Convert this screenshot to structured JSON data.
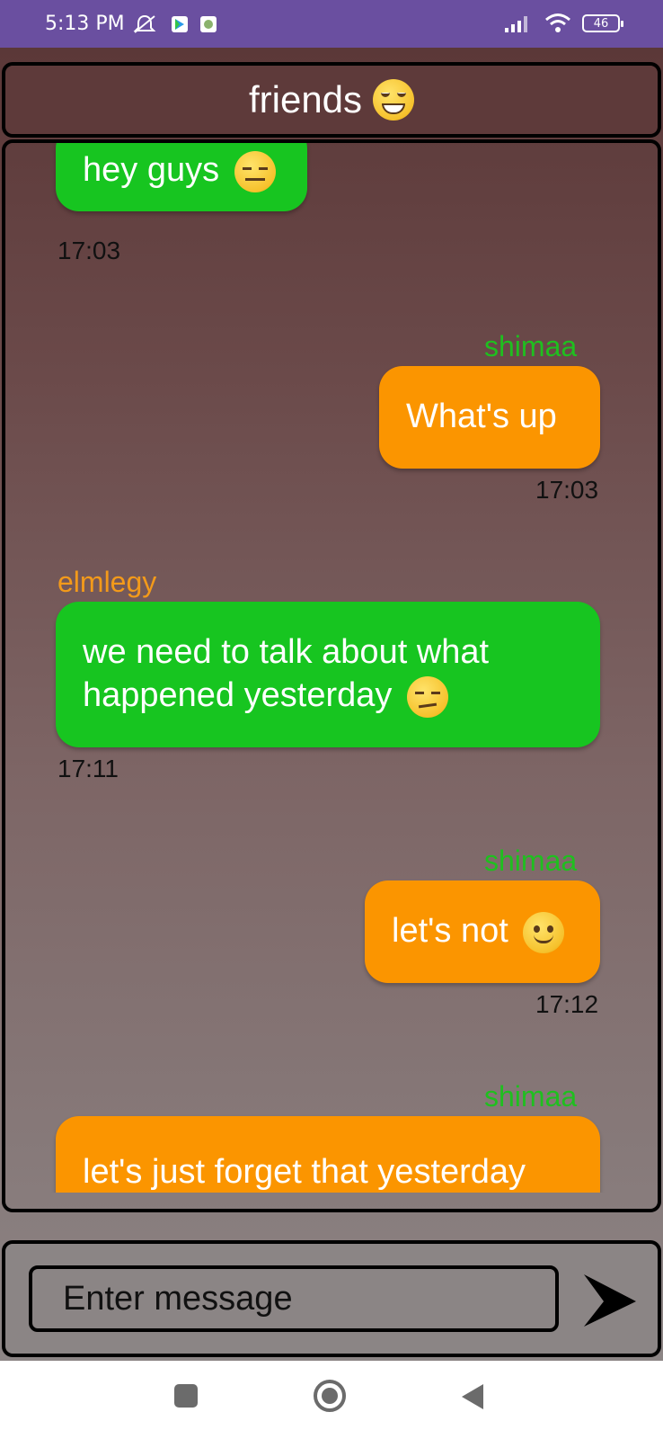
{
  "status_bar": {
    "time": "5:13 PM",
    "battery": "46",
    "icons": [
      "mute-icon",
      "app-icon-1",
      "app-icon-2",
      "signal-icon",
      "wifi-icon",
      "battery-icon"
    ]
  },
  "header": {
    "title": "friends",
    "emoji": "grinning-emoji-icon"
  },
  "messages": [
    {
      "sender": "",
      "text": "hey guys",
      "emoji": "expressionless-emoji-icon",
      "time": "17:03",
      "side": "left",
      "color": "#17c520"
    },
    {
      "sender": "shimaa",
      "text": "What's up",
      "time": "17:03",
      "side": "right",
      "color": "#fb9500"
    },
    {
      "sender": "elmlegy",
      "text_line1": "we need to talk about what",
      "text_line2": "happened yesterday",
      "emoji": "unamused-emoji-icon",
      "time": "17:11",
      "side": "left",
      "color": "#17c520"
    },
    {
      "sender": "shimaa",
      "text": "let's not",
      "emoji": "slight-smile-emoji-icon",
      "time": "17:12",
      "side": "right",
      "color": "#fb9500"
    },
    {
      "sender": "shimaa",
      "text": "let's just forget that yesterday",
      "side": "left",
      "color": "#fb9500"
    }
  ],
  "composer": {
    "placeholder": "Enter message",
    "send_icon": "send-arrow-icon"
  },
  "nav": {
    "icons": [
      "recents-square-icon",
      "home-circle-icon",
      "back-triangle-icon"
    ]
  }
}
